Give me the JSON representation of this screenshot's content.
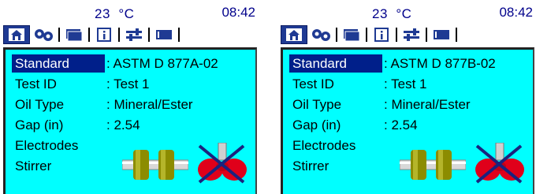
{
  "screens": [
    {
      "temperature": "23",
      "temperature_unit": "°C",
      "time": "08:42",
      "tabs": [
        "home-icon",
        "settings-gears-icon",
        "folders-icon",
        "info-icon",
        "sliders-icon",
        "display-icon"
      ],
      "fields": [
        {
          "label": "Standard",
          "value": ": ASTM D 877A-02"
        },
        {
          "label": "Test ID",
          "value": ": Test 1"
        },
        {
          "label": "Oil Type",
          "value": ": Mineral/Ester"
        },
        {
          "label": "Gap (in)",
          "value": ": 2.54"
        },
        {
          "label": "Electrodes",
          "value": ""
        },
        {
          "label": "Stirrer",
          "value": ""
        }
      ],
      "stirrer_disabled": true
    },
    {
      "temperature": "23",
      "temperature_unit": "°C",
      "time": "08:42",
      "tabs": [
        "home-icon",
        "settings-gears-icon",
        "folders-icon",
        "info-icon",
        "sliders-icon",
        "display-icon"
      ],
      "fields": [
        {
          "label": "Standard",
          "value": ": ASTM D 877B-02"
        },
        {
          "label": "Test ID",
          "value": ": Test 1"
        },
        {
          "label": "Oil Type",
          "value": ": Mineral/Ester"
        },
        {
          "label": "Gap (in)",
          "value": ": 2.54"
        },
        {
          "label": "Electrodes",
          "value": ""
        },
        {
          "label": "Stirrer",
          "value": ""
        }
      ],
      "stirrer_disabled": true
    }
  ],
  "colors": {
    "panel_background": "#00ffff",
    "selection": "#001f8a",
    "header_text": "#00008b",
    "electrode": "#8c8c00",
    "stirrer": "#e0001a",
    "disabled_cross": "#1a237e"
  }
}
